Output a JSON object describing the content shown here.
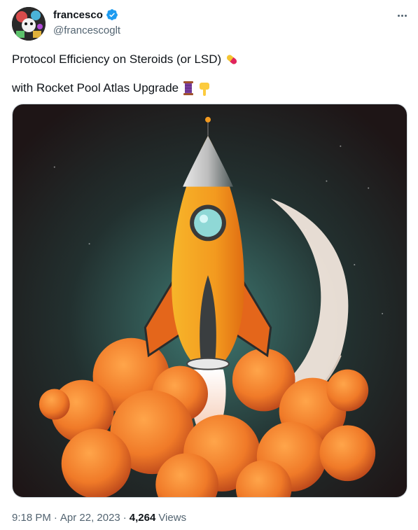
{
  "author": {
    "display_name": "francesco",
    "handle": "@francescoglt",
    "verified": true,
    "avatar_icon": "avatar-image",
    "verified_icon": "verified-badge-icon",
    "verified_color": "#1d9bf0"
  },
  "tweet": {
    "text_line_1": "Protocol Efficiency on Steroids (or LSD)",
    "text_line_1_emoji": "pill-emoji",
    "text_line_2": "with Rocket Pool Atlas Upgrade",
    "text_line_2_emojis": [
      "thread-emoji",
      "pointing-down-emoji"
    ]
  },
  "media": {
    "kind": "illustration",
    "colors": {
      "rocket_body": "#f39a1f",
      "smoke": "#f07a28",
      "background": "#23302f"
    }
  },
  "meta": {
    "time": "9:18 PM",
    "separator_1": "·",
    "date": "Apr 22, 2023",
    "separator_2": "·",
    "views_count": "4,264",
    "views_label": "Views"
  },
  "actions": {
    "more_icon": "more-horizontal-icon"
  }
}
